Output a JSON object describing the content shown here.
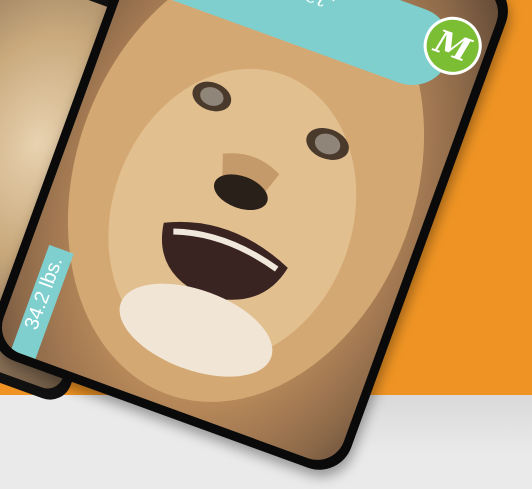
{
  "card": {
    "banner_text": "ng \"secret\"",
    "badge_letter": "M",
    "weight_label": "34.2 lbs."
  },
  "colors": {
    "background_orange": "#ef9424",
    "background_grey": "#eaeaea",
    "card_border": "#0a0a0a",
    "banner_teal": "#7fcfcf",
    "badge_green": "#7bbd33"
  },
  "image": {
    "subject": "lion cub face photo"
  }
}
